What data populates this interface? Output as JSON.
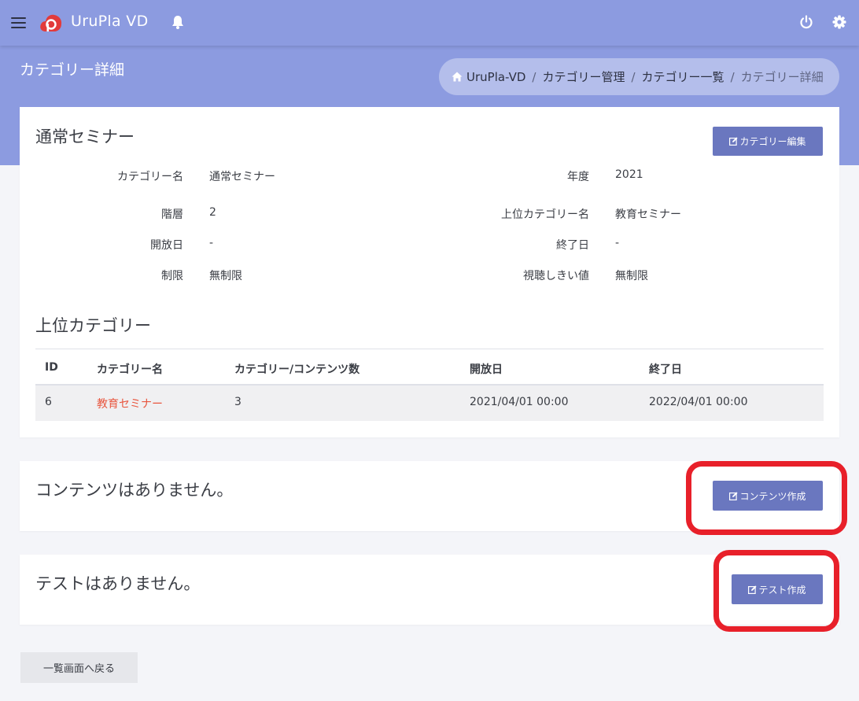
{
  "app": {
    "title": "UruPla VD"
  },
  "header": {
    "page_title": "カテゴリー詳細",
    "breadcrumb": {
      "home": "UruPla-VD",
      "items": [
        "カテゴリー管理",
        "カテゴリー一覧"
      ],
      "current": "カテゴリー詳細",
      "separator": "/"
    }
  },
  "detail": {
    "title": "通常セミナー",
    "edit_button": "カテゴリー編集",
    "fields_left": [
      {
        "label": "カテゴリー名",
        "value": "通常セミナー"
      },
      {
        "label": "階層",
        "value": "2"
      },
      {
        "label": "開放日",
        "value": "-"
      },
      {
        "label": "制限",
        "value": "無制限"
      }
    ],
    "fields_right": [
      {
        "label": "年度",
        "value": "2021"
      },
      {
        "label": "上位カテゴリー名",
        "value": "教育セミナー"
      },
      {
        "label": "終了日",
        "value": "-"
      },
      {
        "label": "視聴しきい値",
        "value": "無制限"
      }
    ]
  },
  "parent_section": {
    "title": "上位カテゴリー",
    "columns": [
      "ID",
      "カテゴリー名",
      "カテゴリー/コンテンツ数",
      "開放日",
      "終了日"
    ],
    "rows": [
      {
        "id": "6",
        "name": "教育セミナー",
        "count": "3",
        "open": "2021/04/01 00:00",
        "end": "2022/04/01 00:00"
      }
    ]
  },
  "contents_section": {
    "empty_text": "コンテンツはありません。",
    "create_button": "コンテンツ作成"
  },
  "tests_section": {
    "empty_text": "テストはありません。",
    "create_button": "テスト作成"
  },
  "footer": {
    "back_button": "一覧画面へ戻る"
  },
  "colors": {
    "header_bg": "#8c9be0",
    "primary_button": "#6a77bf",
    "link": "#e8563f",
    "highlight": "#e8202a",
    "logo": "#e23b3b"
  },
  "icons": [
    "menu-icon",
    "logo-icon",
    "bell-icon",
    "power-icon",
    "gear-icon",
    "home-icon",
    "edit-icon"
  ]
}
